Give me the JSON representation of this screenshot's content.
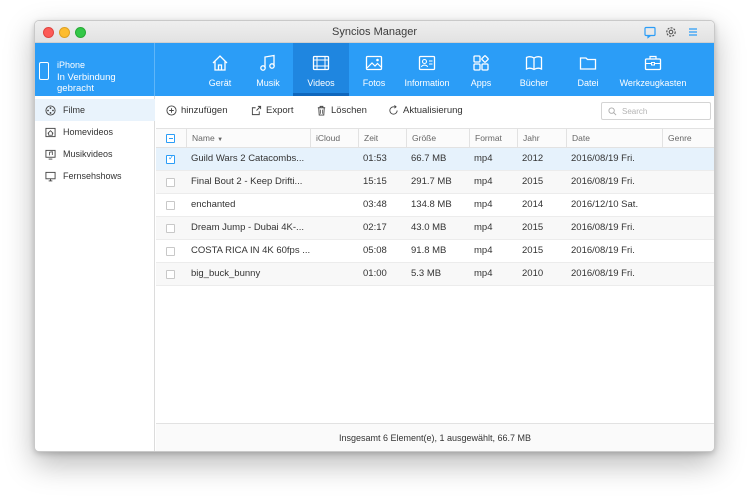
{
  "window": {
    "title": "Syncios Manager"
  },
  "device": {
    "name": "iPhone",
    "status": "In Verbindung gebracht"
  },
  "nav": [
    {
      "label": "Gerät",
      "icon": "home-icon"
    },
    {
      "label": "Musik",
      "icon": "music-icon"
    },
    {
      "label": "Videos",
      "icon": "video-icon",
      "active": true
    },
    {
      "label": "Fotos",
      "icon": "photo-icon"
    },
    {
      "label": "Information",
      "icon": "contact-card-icon"
    },
    {
      "label": "Apps",
      "icon": "apps-icon"
    },
    {
      "label": "Bücher",
      "icon": "book-icon"
    },
    {
      "label": "Datei",
      "icon": "folder-icon"
    },
    {
      "label": "Werkzeugkasten",
      "icon": "toolbox-icon"
    }
  ],
  "sidebar": {
    "items": [
      {
        "label": "Filme",
        "icon": "film-reel-icon",
        "active": true
      },
      {
        "label": "Homevideos",
        "icon": "home-video-icon"
      },
      {
        "label": "Musikvideos",
        "icon": "music-video-icon"
      },
      {
        "label": "Fernsehshows",
        "icon": "tv-icon"
      }
    ]
  },
  "toolbar": {
    "add_label": "hinzufügen",
    "export_label": "Export",
    "delete_label": "Löschen",
    "refresh_label": "Aktualisierung",
    "search_placeholder": "Search"
  },
  "table": {
    "headers": {
      "name": "Name",
      "icloud": "iCloud",
      "time": "Zeit",
      "size": "Größe",
      "format": "Format",
      "year": "Jahr",
      "date": "Date",
      "genre": "Genre"
    },
    "rows": [
      {
        "name": "Guild Wars 2 Catacombs...",
        "time": "01:53",
        "size": "66.7 MB",
        "format": "mp4",
        "year": "2012",
        "date": "2016/08/19 Fri.",
        "checked": true
      },
      {
        "name": "Final Bout 2 - Keep Drifti...",
        "time": "15:15",
        "size": "291.7 MB",
        "format": "mp4",
        "year": "2015",
        "date": "2016/08/19 Fri.",
        "checked": false
      },
      {
        "name": "enchanted",
        "time": "03:48",
        "size": "134.8 MB",
        "format": "mp4",
        "year": "2014",
        "date": "2016/12/10 Sat.",
        "checked": false
      },
      {
        "name": "Dream Jump - Dubai 4K-...",
        "time": "02:17",
        "size": "43.0 MB",
        "format": "mp4",
        "year": "2015",
        "date": "2016/08/19 Fri.",
        "checked": false
      },
      {
        "name": "COSTA RICA IN 4K 60fps ...",
        "time": "05:08",
        "size": "91.8 MB",
        "format": "mp4",
        "year": "2015",
        "date": "2016/08/19 Fri.",
        "checked": false
      },
      {
        "name": "big_buck_bunny",
        "time": "01:00",
        "size": "5.3 MB",
        "format": "mp4",
        "year": "2010",
        "date": "2016/08/19 Fri.",
        "checked": false
      }
    ]
  },
  "status": {
    "text": "Insgesamt 6 Element(e), 1 ausgewählt, 66.7 MB"
  },
  "colors": {
    "accent": "#2b9df7",
    "accent_dark": "#1f86e0",
    "selected_row": "#e6f2fc"
  }
}
